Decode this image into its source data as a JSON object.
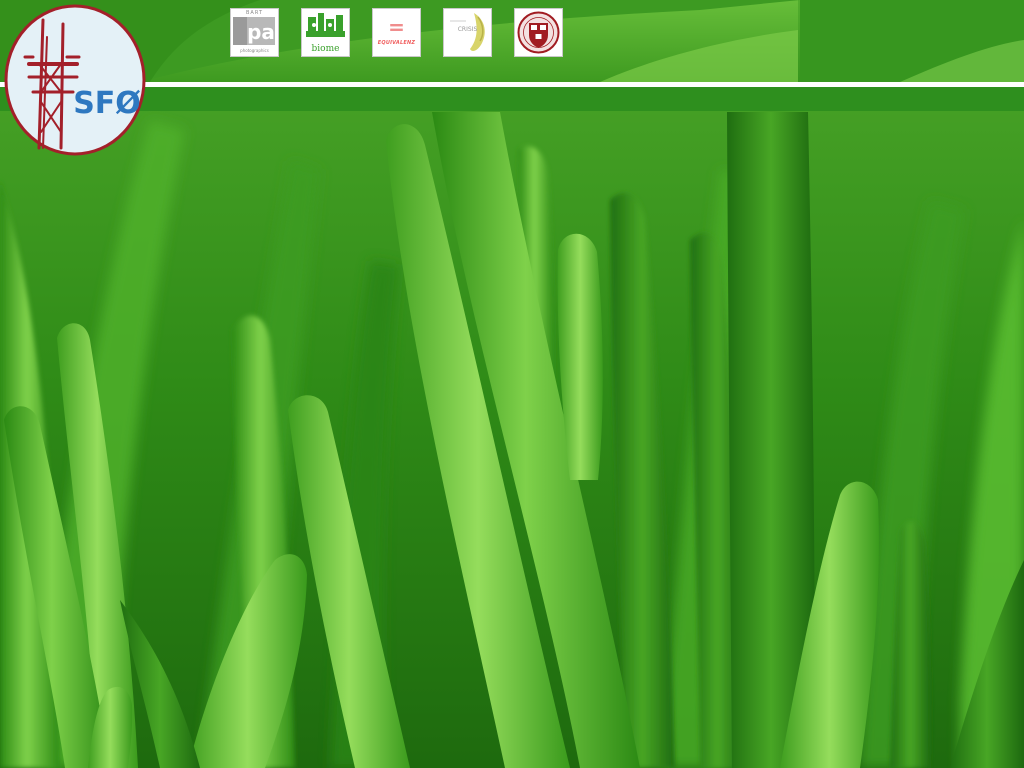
{
  "logo": {
    "text": "SFØ",
    "icon": "sutro-tower-icon",
    "colors": {
      "ring": "#a3202a",
      "text": "#2e78c0",
      "tower": "#a3202a",
      "bg": "#e4f1f7"
    }
  },
  "thumbnails": [
    {
      "id": "pa",
      "icon": "pa-logo-icon",
      "top_text": "BART",
      "main_text": "pa",
      "bottom_text": "photographics"
    },
    {
      "id": "biome",
      "icon": "biome-logo-icon",
      "main_text": "biome"
    },
    {
      "id": "equivalenz",
      "icon": "equivalenz-logo-icon",
      "main_text": "EQUIVALENZ",
      "symbol": "="
    },
    {
      "id": "crisis",
      "icon": "crisis-logo-icon",
      "main_text": "CRISIS"
    },
    {
      "id": "harvard",
      "icon": "harvard-shield-icon"
    }
  ],
  "colors": {
    "header": "#4aa626",
    "nav_bar": "#2e8f1e",
    "divider": "#ffffff",
    "grass_light": "#7fd14a",
    "grass_dark": "#1f6b10"
  }
}
